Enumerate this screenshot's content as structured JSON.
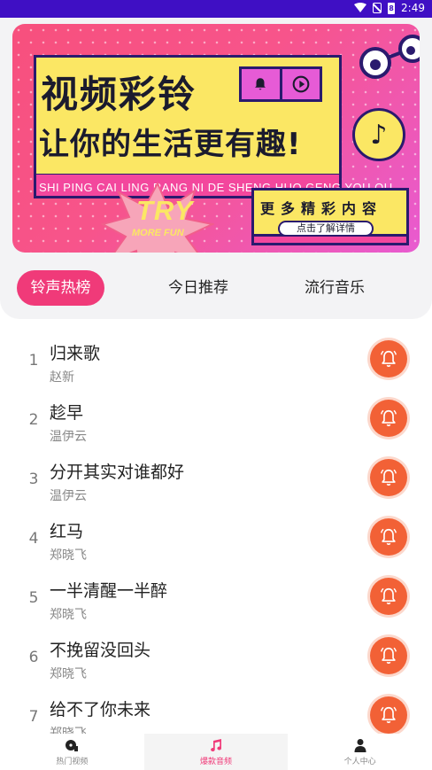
{
  "status_bar": {
    "time": "2:49",
    "battery": "8"
  },
  "banner": {
    "headline1": "视频彩铃",
    "headline2": "让你的生活更有趣!",
    "pinyin": "SHI PING CAI LING RANG NI DE SHENG HUO GENG YOU QU",
    "more_title": "更多精彩内容",
    "more_button": "点击了解详情",
    "try_text": "TRY",
    "more_fun_text": "MORE FUN"
  },
  "tabs": [
    {
      "label": "铃声热榜",
      "active": true
    },
    {
      "label": "今日推荐",
      "active": false
    },
    {
      "label": "流行音乐",
      "active": false
    }
  ],
  "songs": [
    {
      "rank": "1",
      "title": "归来歌",
      "artist": "赵新"
    },
    {
      "rank": "2",
      "title": "趁早",
      "artist": "温伊云"
    },
    {
      "rank": "3",
      "title": "分开其实对谁都好",
      "artist": "温伊云"
    },
    {
      "rank": "4",
      "title": "红马",
      "artist": "郑晓飞"
    },
    {
      "rank": "5",
      "title": "一半清醒一半醉",
      "artist": "郑晓飞"
    },
    {
      "rank": "6",
      "title": "不挽留没回头",
      "artist": "郑晓飞"
    },
    {
      "rank": "7",
      "title": "给不了你未来",
      "artist": "郑晓飞"
    }
  ],
  "bottom_nav": [
    {
      "label": "热门视频",
      "icon": "video-disc-icon",
      "active": false
    },
    {
      "label": "爆款音频",
      "icon": "music-note-icon",
      "active": true
    },
    {
      "label": "个人中心",
      "icon": "person-icon",
      "active": false
    }
  ],
  "colors": {
    "accent": "#f03a79",
    "ring_button": "#f26136",
    "status_bar": "#3f0fc4"
  }
}
